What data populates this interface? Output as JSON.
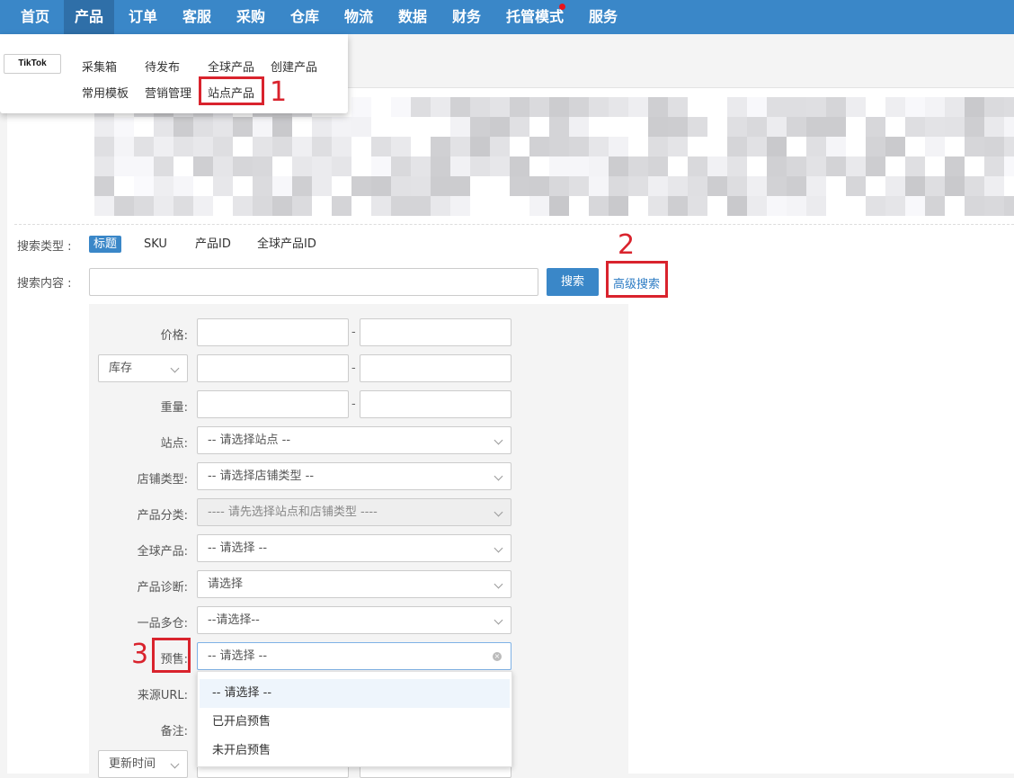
{
  "nav": {
    "items": [
      "首页",
      "产品",
      "订单",
      "客服",
      "采购",
      "仓库",
      "物流",
      "数据",
      "财务",
      "托管模式",
      "服务"
    ],
    "active_index": 1,
    "badge_on_item": "托管模式"
  },
  "dropdown_menu": {
    "logo_text": "TikTok",
    "row1": [
      "采集箱",
      "待发布",
      "全球产品",
      "创建产品"
    ],
    "row2": [
      "常用模板",
      "营销管理",
      "站点产品"
    ]
  },
  "annotations": {
    "n1": "1",
    "n2": "2",
    "n3": "3",
    "color": "#d9232d"
  },
  "search": {
    "type_label": "搜索类型 :",
    "types": [
      "标题",
      "SKU",
      "产品ID",
      "全球产品ID"
    ],
    "active_type": "标题",
    "content_label": "搜索内容 :",
    "search_button": "搜索",
    "advanced_link": "高级搜索"
  },
  "advanced": {
    "price_label": "价格:",
    "stock_select": "库存",
    "weight_label": "重量:",
    "range_sep": "-",
    "site_label": "站点:",
    "site_value": "-- 请选择站点 --",
    "shop_type_label": "店铺类型:",
    "shop_type_value": "-- 请选择店铺类型 --",
    "category_label": "产品分类:",
    "category_value": "---- 请先选择站点和店铺类型 ----",
    "global_label": "全球产品:",
    "global_value": "-- 请选择 --",
    "diagnosis_label": "产品诊断:",
    "diagnosis_value": "请选择",
    "multi_wh_label": "一品多仓:",
    "multi_wh_value": "--请选择--",
    "presale_label": "预售:",
    "presale_value": "-- 请选择 --",
    "source_url_label": "来源URL:",
    "note_label": "备注:",
    "update_time_select": "更新时间",
    "presale_options": [
      "-- 请选择 --",
      "已开启预售",
      "未开启预售"
    ]
  },
  "colors": {
    "brand_blue": "#3a87c8",
    "link_blue": "#2d7cc4"
  }
}
